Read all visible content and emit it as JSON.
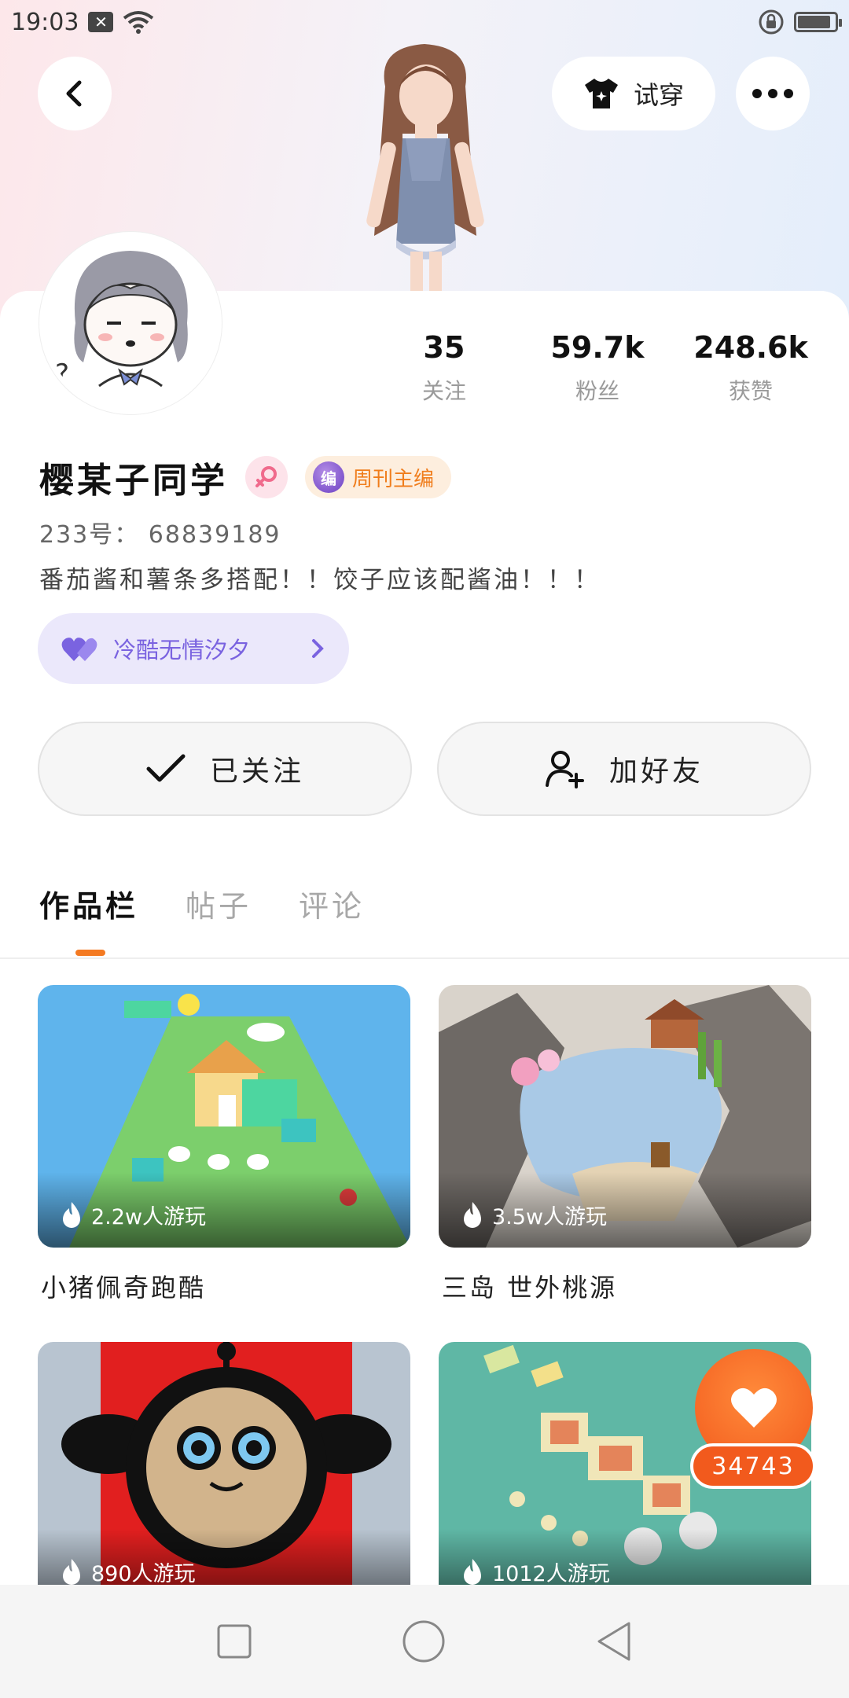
{
  "status_bar": {
    "time": "19:03"
  },
  "header": {
    "try_on_label": "试穿"
  },
  "stats": [
    {
      "value": "35",
      "label": "关注"
    },
    {
      "value": "59.7k",
      "label": "粉丝"
    },
    {
      "value": "248.6k",
      "label": "获赞"
    }
  ],
  "profile": {
    "username": "樱某子同学",
    "badge_label": "周刊主编",
    "badge_icon_text": "编",
    "id_text": "233号：  68839189",
    "bio": "番茄酱和薯条多搭配！！饺子应该配酱油！！！",
    "relation_label": "冷酷无情汐夕"
  },
  "actions": {
    "follow_label": "已关注",
    "add_friend_label": "加好友"
  },
  "tabs": [
    {
      "label": "作品栏",
      "active": true
    },
    {
      "label": "帖子",
      "active": false
    },
    {
      "label": "评论",
      "active": false
    }
  ],
  "works": [
    {
      "plays": "2.2w人游玩",
      "title": "小猪佩奇跑酷"
    },
    {
      "plays": "3.5w人游玩",
      "title": "三岛 世外桃源"
    },
    {
      "plays": "890人游玩",
      "title": ""
    },
    {
      "plays": "1012人游玩",
      "title": ""
    }
  ],
  "like_float": {
    "count": "34743"
  },
  "colors": {
    "accent": "#f47a22",
    "like": "#f25a1d",
    "relation": "#7a63e0"
  }
}
